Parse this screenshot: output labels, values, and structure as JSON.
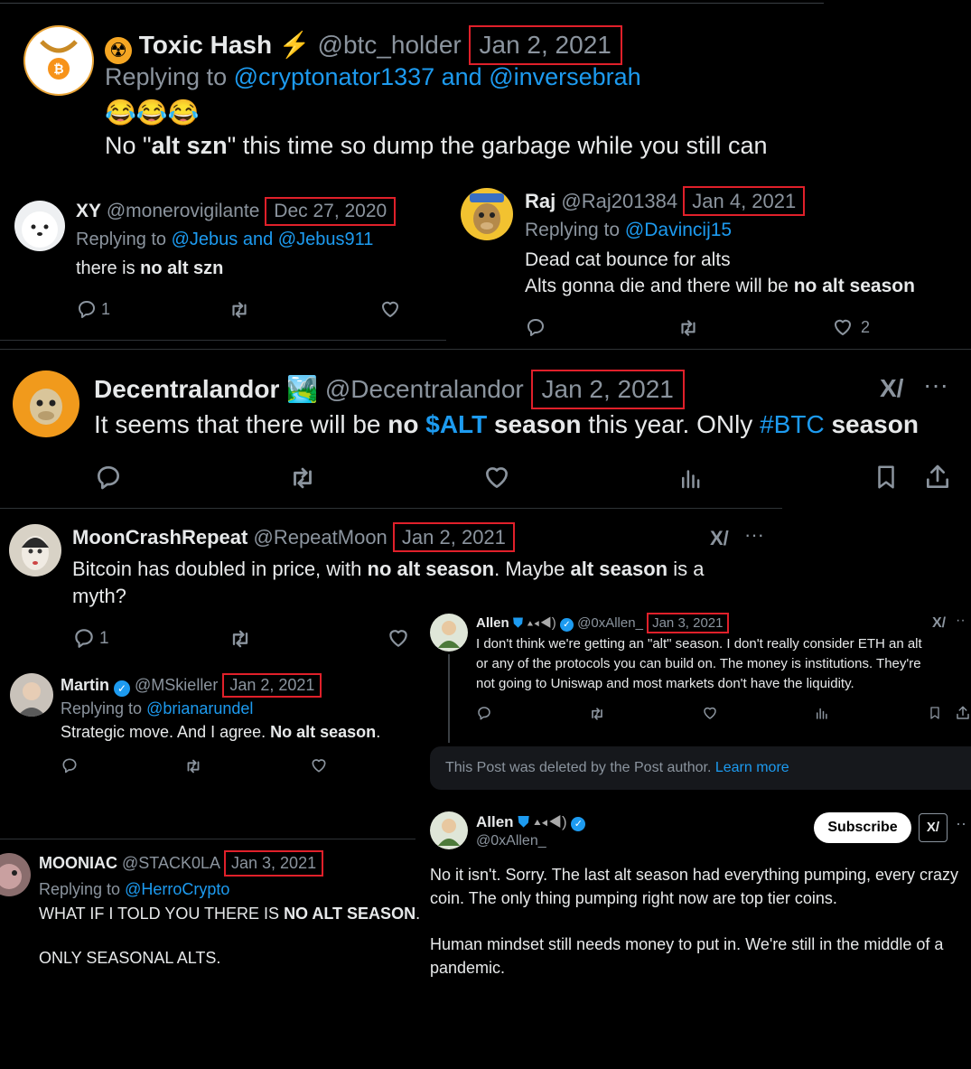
{
  "t1": {
    "name": "Toxic Hash",
    "handle": "@btc_holder",
    "date": "Jan 2, 2021",
    "reply_prefix": "Replying to",
    "reply_to": "@cryptonator1337 and @inversebrah",
    "emoji": "😂😂😂",
    "text_pre": "No \"",
    "text_bold": "alt szn",
    "text_post": "\" this time so dump the garbage while you still can"
  },
  "t2": {
    "name": "XY",
    "handle": "@monerovigilante",
    "date": "Dec 27, 2020",
    "reply_prefix": "Replying to",
    "reply_to": "@Jebus and @Jebus911",
    "text_pre": "there is ",
    "text_bold": "no alt szn",
    "reply_count": "1"
  },
  "t3": {
    "name": "Raj",
    "handle": "@Raj201384",
    "date": "Jan 4, 2021",
    "reply_prefix": "Replying to",
    "reply_to": "@Davincij15",
    "line1": "Dead cat bounce for alts",
    "line2_pre": "Alts gonna die and there will be ",
    "line2_bold": "no alt season",
    "like_count": "2"
  },
  "t4": {
    "name": "Decentralandor",
    "emoji": "🏞️",
    "handle": "@Decentralandor",
    "date": "Jan 2, 2021",
    "p1": "It seems that there will be ",
    "b1": "no ",
    "tag1": "$ALT",
    "b2": " season",
    "p2": " this year. ONly ",
    "tag2": "#BTC",
    "b3": " season"
  },
  "t5": {
    "name": "MoonCrashRepeat",
    "handle": "@RepeatMoon",
    "date": "Jan 2, 2021",
    "p1": "Bitcoin has doubled in price, with ",
    "b1": "no alt season",
    "p2": ". Maybe ",
    "b2": "alt season",
    "p3": " is a",
    "line2": "myth?",
    "reply_count": "1"
  },
  "t6": {
    "name": "Allen",
    "handle": "@0xAllen_",
    "date": "Jan 3, 2021",
    "line1": "I don't think we're getting an \"alt\" season. I don't really consider ETH an alt",
    "line2": "or any of the protocols you can build on. The money is institutions. They're",
    "line3": "not going to Uniswap and most markets don't have the liquidity."
  },
  "deleted": {
    "text": "This Post was deleted by the Post author.",
    "link": "Learn more"
  },
  "t7": {
    "name": "Martin",
    "handle": "@MSkieller",
    "date": "Jan 2, 2021",
    "reply_prefix": "Replying to",
    "reply_to": "@brianarundel",
    "text_pre": "Strategic move. And I agree. ",
    "text_bold": "No alt season",
    "text_post": "."
  },
  "t8": {
    "name": "Allen",
    "handle": "@0xAllen_",
    "subscribe": "Subscribe",
    "line1": "No it isn't. Sorry. The last alt season had everything pumping, every crazy",
    "line2": "coin. The only thing pumping right now are top tier coins.",
    "line3": "Human mindset still needs money to put in. We're still in the middle of a",
    "line4": "pandemic."
  },
  "t9": {
    "name": "MOONIAC",
    "handle": "@STACK0LA",
    "date": "Jan 3, 2021",
    "reply_prefix": "Replying to",
    "reply_to": "@HerroCrypto",
    "line1_pre": "WHAT IF I TOLD YOU THERE IS ",
    "line1_bold": "NO ALT SEASON",
    "line1_post": ".",
    "line2": "ONLY SEASONAL ALTS."
  },
  "colors": {
    "background": "#000000",
    "link": "#1d9bf0",
    "highlight_box": "#e0202a",
    "muted": "#8b949e",
    "verified": "#1d9bf0"
  }
}
